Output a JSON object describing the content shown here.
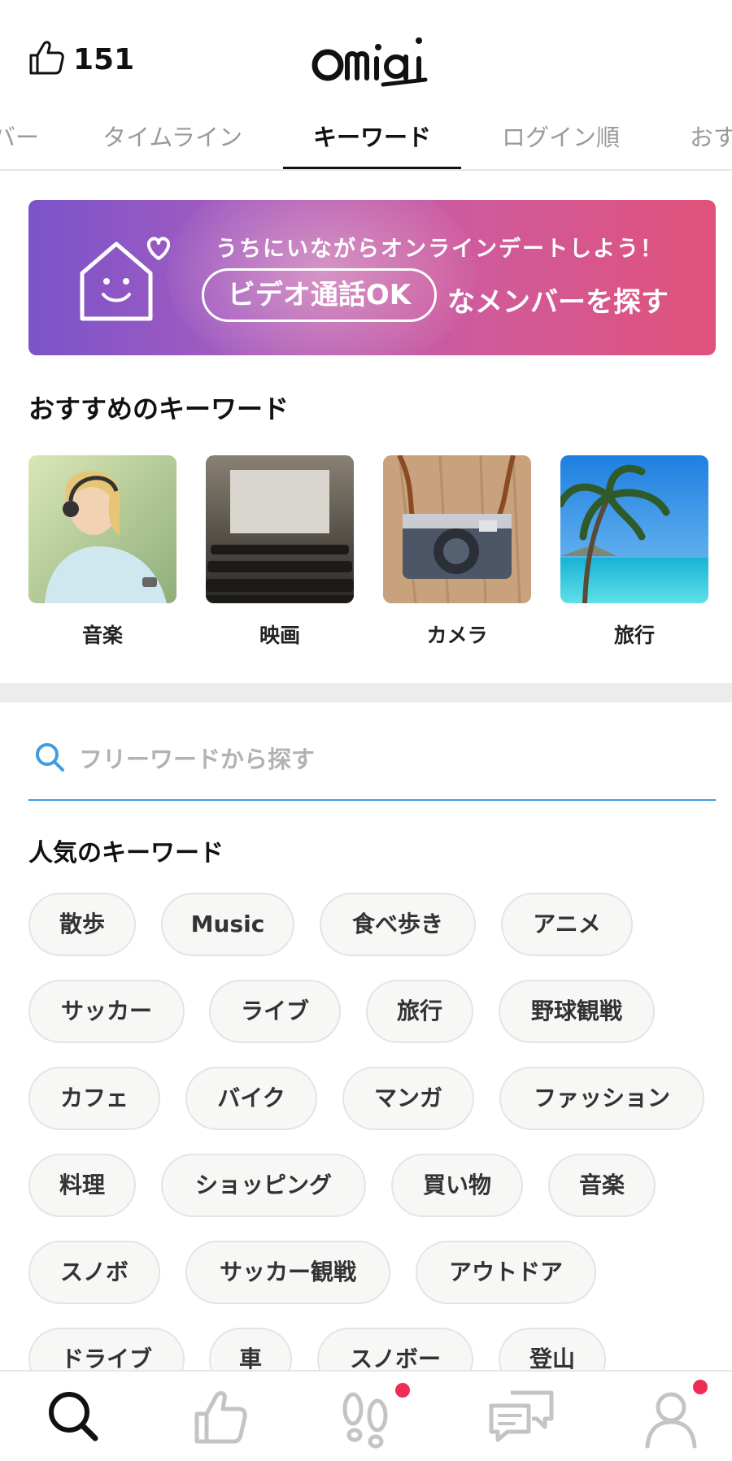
{
  "header": {
    "likes_count": "151",
    "logo_text": "Omiai"
  },
  "tabs": [
    {
      "label": "バー"
    },
    {
      "label": "タイムライン"
    },
    {
      "label": "キーワード",
      "active": true
    },
    {
      "label": "ログイン順"
    },
    {
      "label": "おす"
    }
  ],
  "banner": {
    "line1": "うちにいながらオンラインデートしよう！",
    "pill": "ビデオ通話OK",
    "line2": "なメンバーを探す"
  },
  "recommended": {
    "title": "おすすめのキーワード",
    "items": [
      {
        "label": "音楽"
      },
      {
        "label": "映画"
      },
      {
        "label": "カメラ"
      },
      {
        "label": "旅行"
      }
    ]
  },
  "search": {
    "placeholder": "フリーワードから探す"
  },
  "popular": {
    "title": "人気のキーワード",
    "rows": [
      [
        "散歩",
        "Music",
        "食べ歩き",
        "アニメ"
      ],
      [
        "サッカー",
        "ライブ",
        "旅行",
        "野球観戦"
      ],
      [
        "カフェ",
        "バイク",
        "マンガ",
        "ファッション"
      ],
      [
        "料理",
        "ショッピング",
        "買い物",
        "音楽"
      ],
      [
        "スノボ",
        "サッカー観戦",
        "アウトドア"
      ],
      [
        "ドライブ",
        "車",
        "スノボー",
        "登山"
      ]
    ]
  },
  "bottom_nav": [
    {
      "icon": "search-icon",
      "active": true
    },
    {
      "icon": "thumbs-up-icon"
    },
    {
      "icon": "footprints-icon",
      "badge": true
    },
    {
      "icon": "chat-bubbles-icon"
    },
    {
      "icon": "user-icon",
      "badge": true
    }
  ],
  "colors": {
    "accent_blue": "#3d9de0",
    "badge_red": "#ef2c55",
    "banner_start": "#7b53c9",
    "banner_end": "#e0527a"
  }
}
